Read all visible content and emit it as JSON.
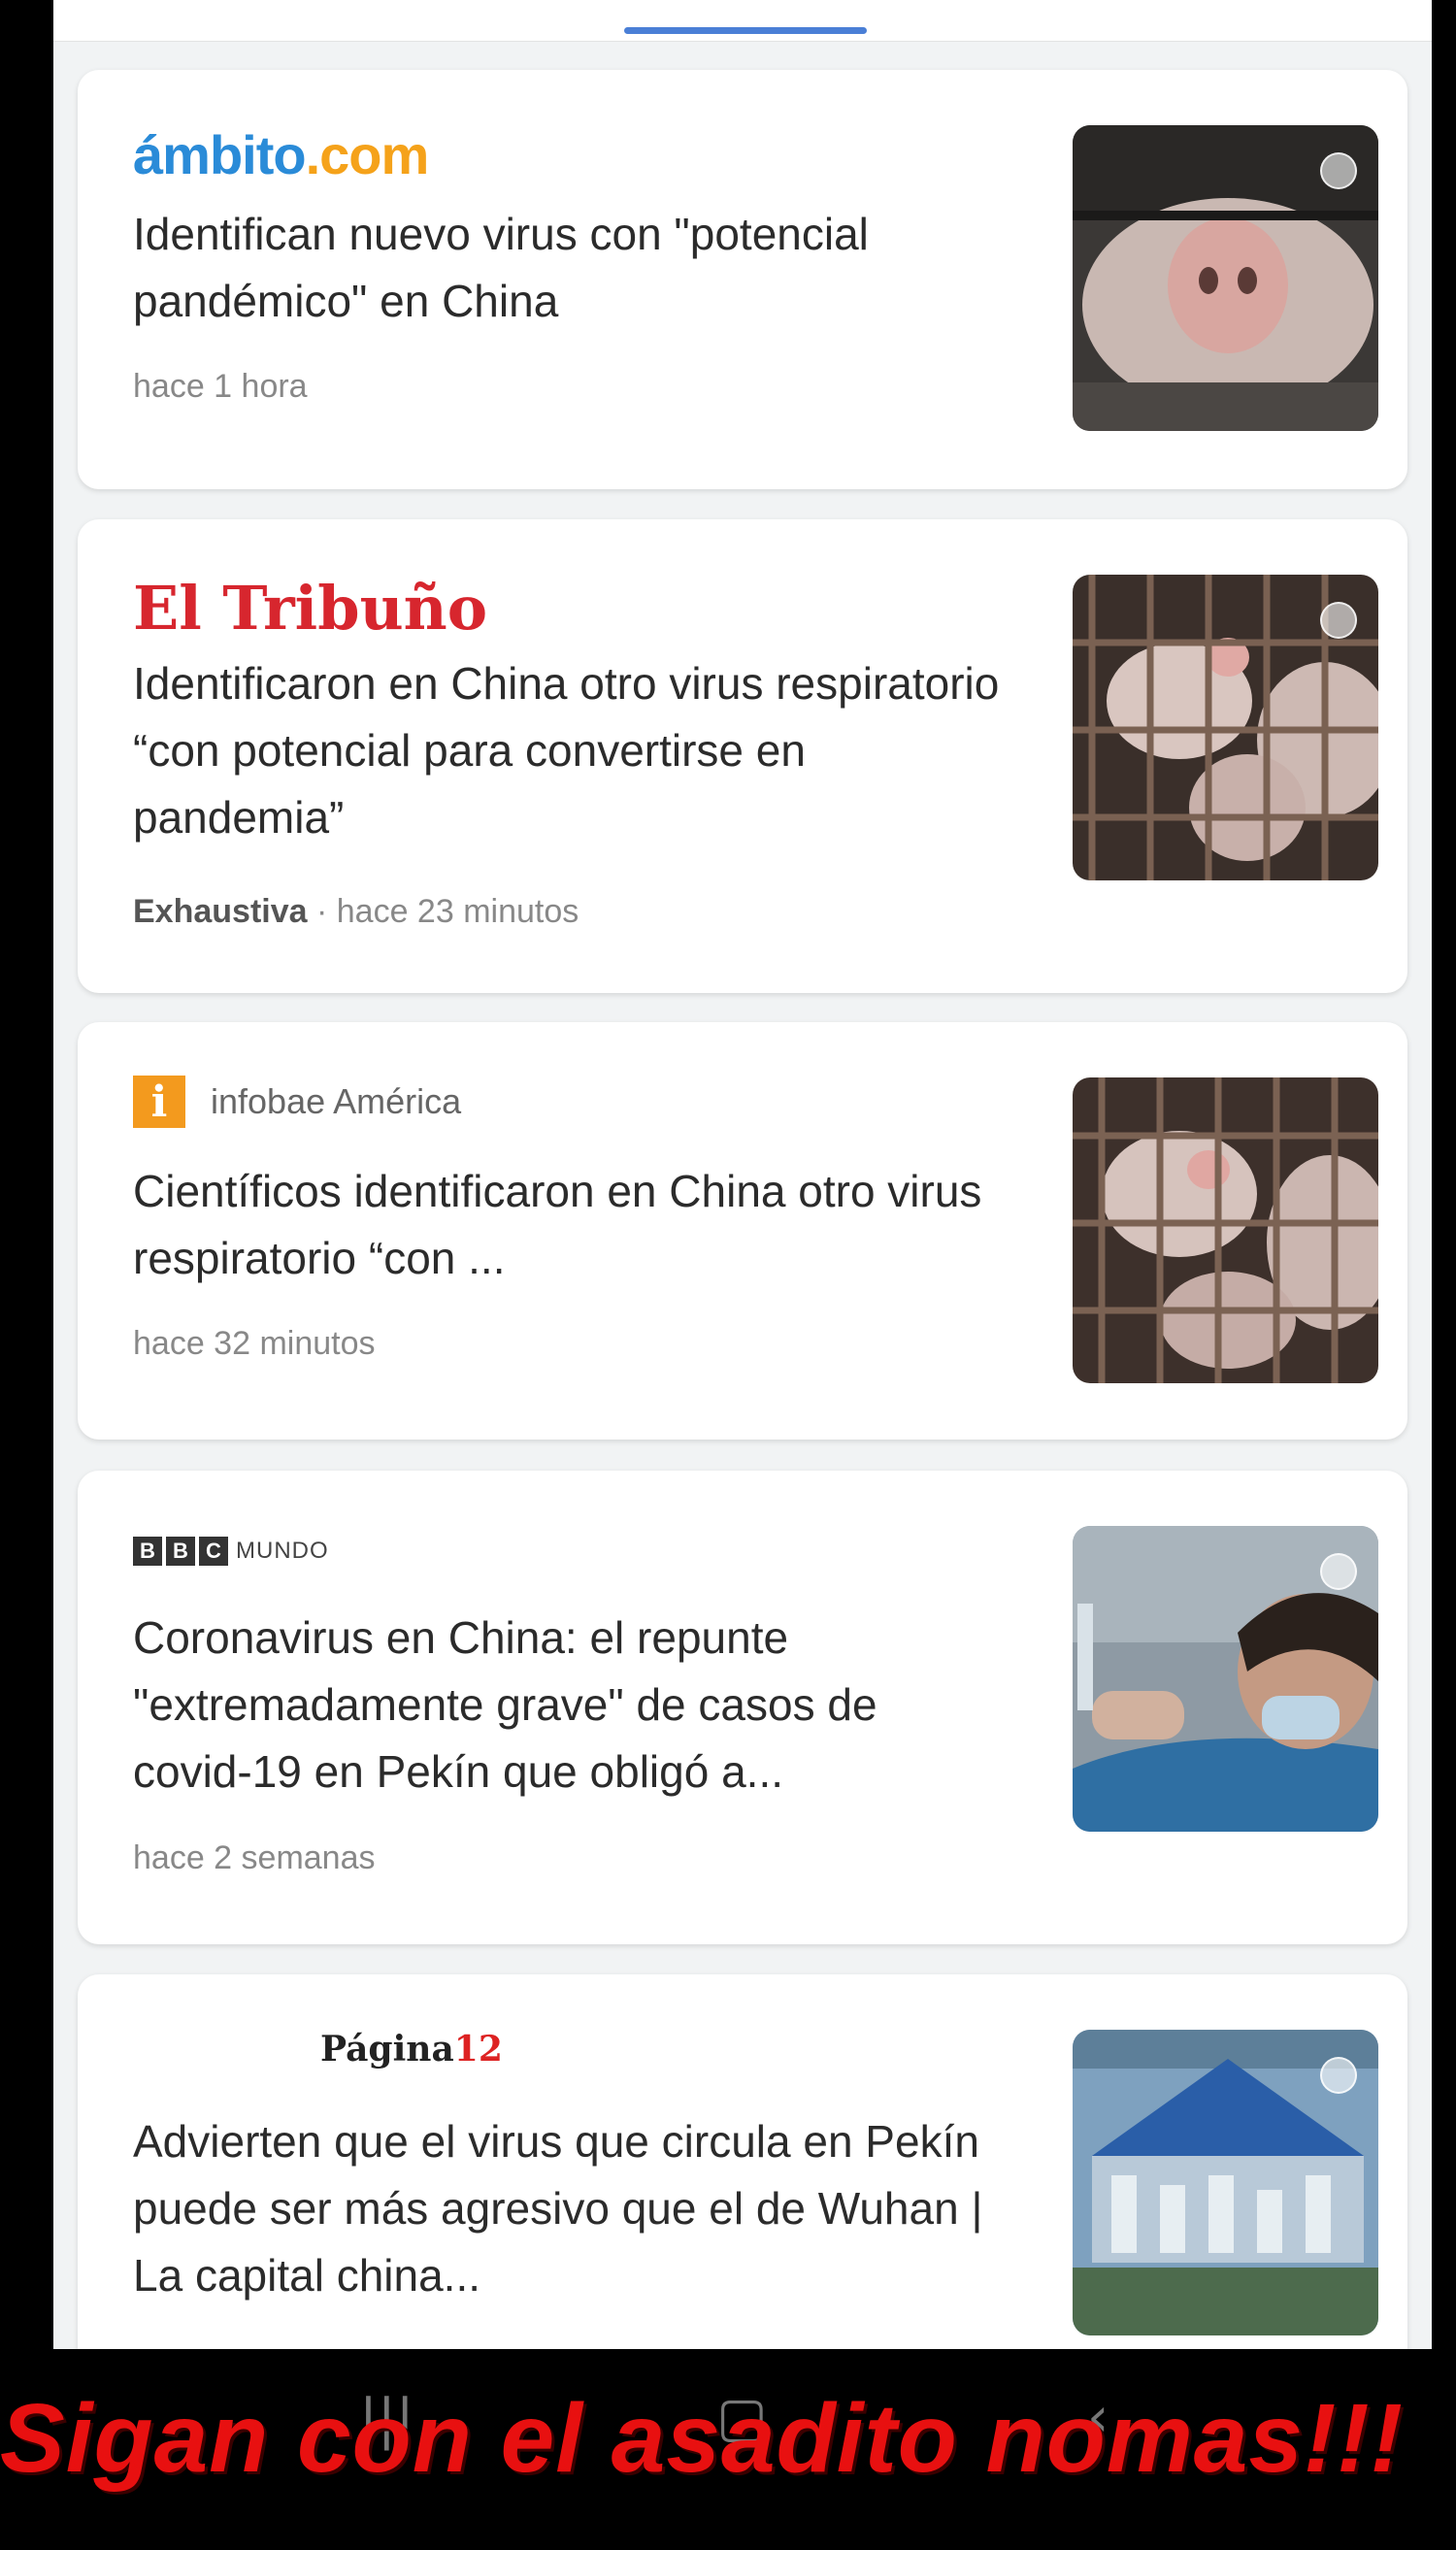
{
  "articles": [
    {
      "source": "ámbito.com",
      "headline": "Identifican nuevo virus con \"potencial pandémico\" en China",
      "author": "",
      "time": "hace 1 hora"
    },
    {
      "source": "El Tribuño",
      "headline": "Identificaron en China otro virus respiratorio “con potencial para convertirse en pandemia”",
      "author": "Exhaustiva",
      "time": "· hace 23 minutos"
    },
    {
      "source": "infobae América",
      "headline": "Científicos identificaron en China otro virus respiratorio “con ...",
      "author": "",
      "time": "hace 32 minutos"
    },
    {
      "source": "MUNDO",
      "headline": "Coronavirus en China: el repunte \"extremadamente grave\" de casos de covid-19 en Pekín que obligó a...",
      "author": "",
      "time": "hace 2 semanas"
    },
    {
      "source": "Página12",
      "headline": "Advierten que el virus que circula en Pekín puede ser más agresivo que el de Wuhan | La capital china...",
      "author": "",
      "time": ""
    }
  ],
  "logos": {
    "ambito_main": "ámbito",
    "ambito_dot": ".com",
    "infobae_letter": "i",
    "bbc_letters": [
      "B",
      "B",
      "C"
    ],
    "pagina_word": "Página",
    "pagina_num": "12"
  },
  "overlay_caption": "Sigan con el asadito nomas!!!",
  "icons": [
    "recent-apps-icon",
    "home-icon",
    "back-icon",
    "menu-dot-icon"
  ],
  "colors": {
    "accent_tab": "#4a7fd6",
    "caption": "#e81010"
  }
}
